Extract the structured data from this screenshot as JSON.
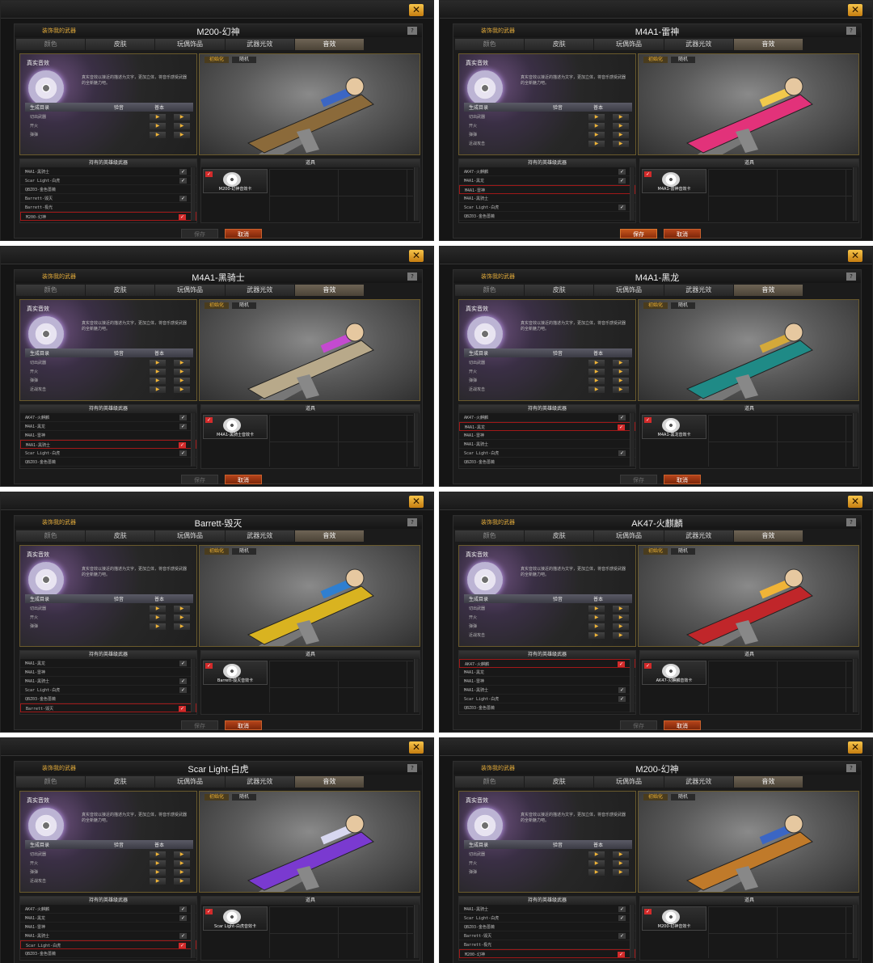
{
  "subtitle": "装饰我的武器",
  "help": "?",
  "close": "✕",
  "tabs": [
    "颜色",
    "皮肤",
    "玩偶饰品",
    "武器光效",
    "音效"
  ],
  "audio_title": "真实音效",
  "audio_desc": "真实音效以接近的描述为文字，更加立体，将音乐感受武器的全新魅力吧。",
  "sound_header": [
    "生成目录",
    "验音",
    "普本"
  ],
  "preview_tabs": [
    "初始化",
    "随机"
  ],
  "hero_header": "持有的英雄级武器",
  "props_header": "道具",
  "save": "保存",
  "cancel": "取消",
  "colors": {
    "accent": "#f0b437",
    "cancel": "#b5431a",
    "check": "#d32b2b"
  },
  "windows": [
    {
      "title": "M200-幻神",
      "sounds": [
        "切出武器",
        "开火",
        "弹弹"
      ],
      "heroes": [
        {
          "name": "M4A1-黑骑士",
          "checked": true,
          "red": false,
          "sel": false
        },
        {
          "name": "Scar Light-白虎",
          "checked": true,
          "red": false,
          "sel": false
        },
        {
          "name": "QBZ03-金色蔷薇",
          "checked": false,
          "red": false,
          "sel": false
        },
        {
          "name": "Barrett-毁灭",
          "checked": true,
          "red": false,
          "sel": false
        },
        {
          "name": "Barrett-极光",
          "checked": false,
          "red": false,
          "sel": false
        },
        {
          "name": "M200-幻神",
          "checked": true,
          "red": true,
          "sel": true
        }
      ],
      "prop": "M200-幻神音效卡",
      "save_active": false,
      "weapon_color": "#8b6a3a",
      "accent2": "#3b66c4"
    },
    {
      "title": "M4A1-雷神",
      "sounds": [
        "切出武器",
        "开火",
        "弹弹",
        "近战攻击"
      ],
      "heroes": [
        {
          "name": "AK47-火麒麟",
          "checked": true,
          "red": false,
          "sel": false
        },
        {
          "name": "M4A1-黑龙",
          "checked": true,
          "red": false,
          "sel": false
        },
        {
          "name": "M4A1-雷神",
          "checked": false,
          "red": false,
          "sel": true
        },
        {
          "name": "M4A1-黑骑士",
          "checked": false,
          "red": false,
          "sel": false
        },
        {
          "name": "Scar Light-白虎",
          "checked": true,
          "red": false,
          "sel": false
        },
        {
          "name": "QBZ03-金色蔷薇",
          "checked": false,
          "red": false,
          "sel": false
        }
      ],
      "prop": "M4A1-雷神音效卡",
      "save_active": true,
      "weapon_color": "#e2327a",
      "accent2": "#f2c94c"
    },
    {
      "title": "M4A1-黑骑士",
      "sounds": [
        "切出武器",
        "开火",
        "弹弹",
        "近战攻击"
      ],
      "heroes": [
        {
          "name": "AK47-火麒麟",
          "checked": true,
          "red": false,
          "sel": false
        },
        {
          "name": "M4A1-黑龙",
          "checked": true,
          "red": false,
          "sel": false
        },
        {
          "name": "M4A1-雷神",
          "checked": false,
          "red": false,
          "sel": false
        },
        {
          "name": "M4A1-黑骑士",
          "checked": true,
          "red": true,
          "sel": true
        },
        {
          "name": "Scar Light-白虎",
          "checked": true,
          "red": false,
          "sel": false
        },
        {
          "name": "QBZ03-金色蔷薇",
          "checked": false,
          "red": false,
          "sel": false
        }
      ],
      "prop": "M4A1-黑骑士音效卡",
      "save_active": false,
      "weapon_color": "#b8a98a",
      "accent2": "#c44ad0"
    },
    {
      "title": "M4A1-黑龙",
      "sounds": [
        "切出武器",
        "开火",
        "弹弹",
        "近战攻击"
      ],
      "heroes": [
        {
          "name": "AK47-火麒麟",
          "checked": true,
          "red": false,
          "sel": false
        },
        {
          "name": "M4A1-黑龙",
          "checked": true,
          "red": true,
          "sel": true
        },
        {
          "name": "M4A1-雷神",
          "checked": false,
          "red": false,
          "sel": false
        },
        {
          "name": "M4A1-黑骑士",
          "checked": false,
          "red": false,
          "sel": false
        },
        {
          "name": "Scar Light-白虎",
          "checked": true,
          "red": false,
          "sel": false
        },
        {
          "name": "QBZ03-金色蔷薇",
          "checked": false,
          "red": false,
          "sel": false
        }
      ],
      "prop": "M4A1-黑龙音效卡",
      "save_active": false,
      "weapon_color": "#1f8a86",
      "accent2": "#d4a93a"
    },
    {
      "title": "Barrett-毁灭",
      "sounds": [
        "切出武器",
        "开火",
        "弹弹"
      ],
      "heroes": [
        {
          "name": "M4A1-黑龙",
          "checked": true,
          "red": false,
          "sel": false
        },
        {
          "name": "M4A1-雷神",
          "checked": false,
          "red": false,
          "sel": false
        },
        {
          "name": "M4A1-黑骑士",
          "checked": true,
          "red": false,
          "sel": false
        },
        {
          "name": "Scar Light-白虎",
          "checked": true,
          "red": false,
          "sel": false
        },
        {
          "name": "QBZ03-金色蔷薇",
          "checked": false,
          "red": false,
          "sel": false
        },
        {
          "name": "Barrett-毁灭",
          "checked": true,
          "red": true,
          "sel": true
        }
      ],
      "prop": "Barrett-毁灭音效卡",
      "save_active": false,
      "weapon_color": "#d9b320",
      "accent2": "#2f7fd0"
    },
    {
      "title": "AK47-火麒麟",
      "sounds": [
        "切出武器",
        "开火",
        "弹弹",
        "近战攻击"
      ],
      "heroes": [
        {
          "name": "AK47-火麒麟",
          "checked": true,
          "red": true,
          "sel": true
        },
        {
          "name": "M4A1-黑龙",
          "checked": false,
          "red": false,
          "sel": false
        },
        {
          "name": "M4A1-雷神",
          "checked": false,
          "red": false,
          "sel": false
        },
        {
          "name": "M4A1-黑骑士",
          "checked": true,
          "red": false,
          "sel": false
        },
        {
          "name": "Scar Light-白虎",
          "checked": true,
          "red": false,
          "sel": false
        },
        {
          "name": "QBZ03-金色蔷薇",
          "checked": false,
          "red": false,
          "sel": false
        }
      ],
      "prop": "AK47-火麒麟音效卡",
      "save_active": false,
      "weapon_color": "#c0262a",
      "accent2": "#f0b437"
    },
    {
      "title": "Scar Light-白虎",
      "sounds": [
        "切出武器",
        "开火",
        "弹弹",
        "近战攻击"
      ],
      "heroes": [
        {
          "name": "AK47-火麒麟",
          "checked": true,
          "red": false,
          "sel": false
        },
        {
          "name": "M4A1-黑龙",
          "checked": true,
          "red": false,
          "sel": false
        },
        {
          "name": "M4A1-雷神",
          "checked": false,
          "red": false,
          "sel": false
        },
        {
          "name": "M4A1-黑骑士",
          "checked": true,
          "red": false,
          "sel": false
        },
        {
          "name": "Scar Light-白虎",
          "checked": true,
          "red": true,
          "sel": true
        },
        {
          "name": "QBZ03-金色蔷薇",
          "checked": false,
          "red": false,
          "sel": false
        }
      ],
      "prop": "Scar Light-白虎音效卡",
      "save_active": false,
      "weapon_color": "#7a3ad0",
      "accent2": "#d8d8f0"
    },
    {
      "title": "M200-幻神",
      "sounds": [
        "切出武器",
        "开火",
        "弹弹"
      ],
      "heroes": [
        {
          "name": "M4A1-黑骑士",
          "checked": true,
          "red": false,
          "sel": false
        },
        {
          "name": "Scar Light-白虎",
          "checked": true,
          "red": false,
          "sel": false
        },
        {
          "name": "QBZ03-金色蔷薇",
          "checked": false,
          "red": false,
          "sel": false
        },
        {
          "name": "Barrett-毁灭",
          "checked": true,
          "red": false,
          "sel": false
        },
        {
          "name": "Barrett-极光",
          "checked": false,
          "red": false,
          "sel": false
        },
        {
          "name": "M200-幻神",
          "checked": true,
          "red": true,
          "sel": true
        }
      ],
      "prop": "M200-幻神音效卡",
      "save_active": false,
      "weapon_color": "#c07a2a",
      "accent2": "#3b66c4"
    }
  ]
}
